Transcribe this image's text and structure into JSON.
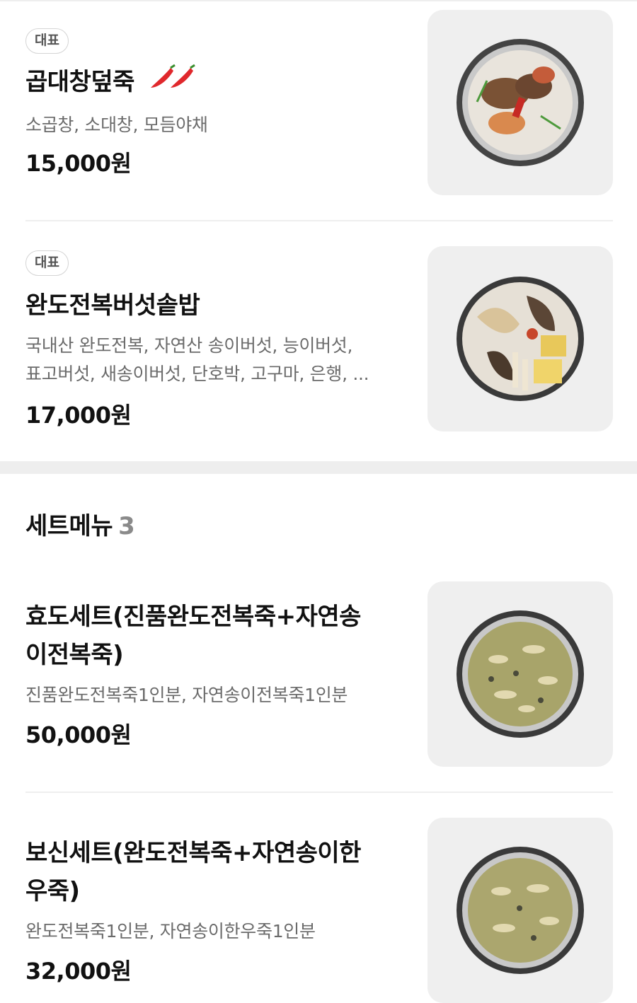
{
  "menu_items": [
    {
      "badge": "대표",
      "name": "곱대창덮죽",
      "spicy_icon": "chili-pepper-icon",
      "description": "소곱창, 소대창, 모듬야채",
      "price": "15,000원"
    },
    {
      "badge": "대표",
      "name": "완도전복버섯솥밥",
      "description_line1": "국내산 완도전복, 자연산 송이버섯, 능이버섯,",
      "description_line2": "표고버섯, 새송이버섯, 단호박, 고구마, 은행, ...",
      "price": "17,000원"
    }
  ],
  "set_section": {
    "title": "세트메뉴",
    "count": "3"
  },
  "set_items": [
    {
      "name_line1": "효도세트(진품완도전복죽+자연송",
      "name_line2": "이전복죽)",
      "description": "진품완도전복죽1인분, 자연송이전복죽1인분",
      "price": "50,000원"
    },
    {
      "name_line1": "보신세트(완도전복죽+자연송이한",
      "name_line2": "우죽)",
      "description": "완도전복죽1인분, 자연송이한우죽1인분",
      "price": "32,000원"
    }
  ],
  "colors": {
    "text_primary": "#111111",
    "text_secondary": "#6b6b6b",
    "divider": "#eeeeee",
    "thumb_bg": "#efefef",
    "spicy_red": "#e0282c"
  }
}
